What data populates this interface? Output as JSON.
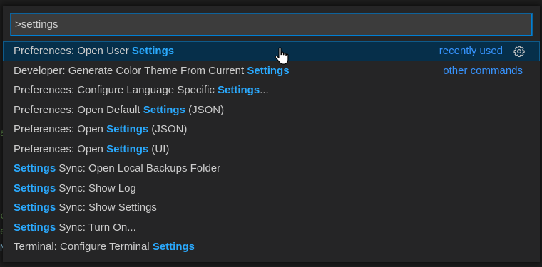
{
  "command_palette": {
    "query": ">settings",
    "items": [
      {
        "before": "Preferences: Open User ",
        "match": "Settings",
        "after": "",
        "hint": "recently used"
      },
      {
        "before": "Developer: Generate Color Theme From Current ",
        "match": "Settings",
        "after": "",
        "hint": "other commands"
      },
      {
        "before": "Preferences: Configure Language Specific ",
        "match": "Settings",
        "after": "...",
        "hint": ""
      },
      {
        "before": "Preferences: Open Default ",
        "match": "Settings",
        "after": " (JSON)",
        "hint": ""
      },
      {
        "before": "Preferences: Open ",
        "match": "Settings",
        "after": " (JSON)",
        "hint": ""
      },
      {
        "before": "Preferences: Open ",
        "match": "Settings",
        "after": " (UI)",
        "hint": ""
      },
      {
        "before": "",
        "match": "Settings",
        "after": " Sync: Open Local Backups Folder",
        "hint": ""
      },
      {
        "before": "",
        "match": "Settings",
        "after": " Sync: Show Log",
        "hint": ""
      },
      {
        "before": "",
        "match": "Settings",
        "after": " Sync: Show Settings",
        "hint": ""
      },
      {
        "before": "",
        "match": "Settings",
        "after": " Sync: Turn On...",
        "hint": ""
      },
      {
        "before": "Terminal: Configure Terminal ",
        "match": "Settings",
        "after": "",
        "hint": ""
      }
    ],
    "icons": {
      "row_action": "gear-icon",
      "pointer": "hand-pointer-icon"
    }
  },
  "colors": {
    "highlight": "#2aaaff",
    "hint": "#3794ff",
    "focus_border": "#007fd4",
    "active_row": "#062f4a"
  }
}
